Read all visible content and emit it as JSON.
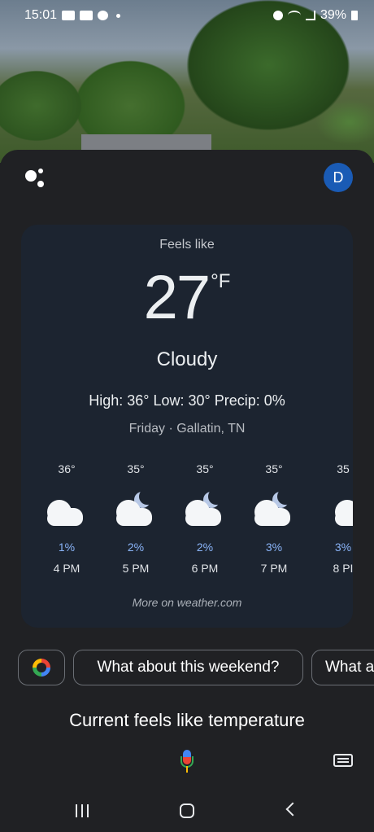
{
  "status_bar": {
    "time": "15:01",
    "battery": "39%"
  },
  "assistant": {
    "avatar_letter": "D"
  },
  "weather": {
    "feels_like_label": "Feels like",
    "temperature": "27",
    "unit": "°F",
    "condition": "Cloudy",
    "high_low_precip": "High: 36° Low: 30° Precip: 0%",
    "day_location": "Friday · Gallatin, TN",
    "hourly": [
      {
        "temp": "36°",
        "precip": "1%",
        "time": "4 PM",
        "icon": "cloudy-icon"
      },
      {
        "temp": "35°",
        "precip": "2%",
        "time": "5 PM",
        "icon": "cloudy-night-icon"
      },
      {
        "temp": "35°",
        "precip": "2%",
        "time": "6 PM",
        "icon": "cloudy-night-icon"
      },
      {
        "temp": "35°",
        "precip": "3%",
        "time": "7 PM",
        "icon": "cloudy-night-icon"
      },
      {
        "temp": "35",
        "precip": "3%",
        "time": "8 PI",
        "icon": "cloudy-icon"
      }
    ],
    "more_link": "More on weather.com"
  },
  "suggestions": {
    "chips": [
      "What about this weekend?",
      "What a"
    ]
  },
  "query_text": "Current feels like temperature",
  "colors": {
    "background": "#202124",
    "card": "#1c2430",
    "precip": "#8ab4f8",
    "avatar": "#1a5bb5"
  }
}
